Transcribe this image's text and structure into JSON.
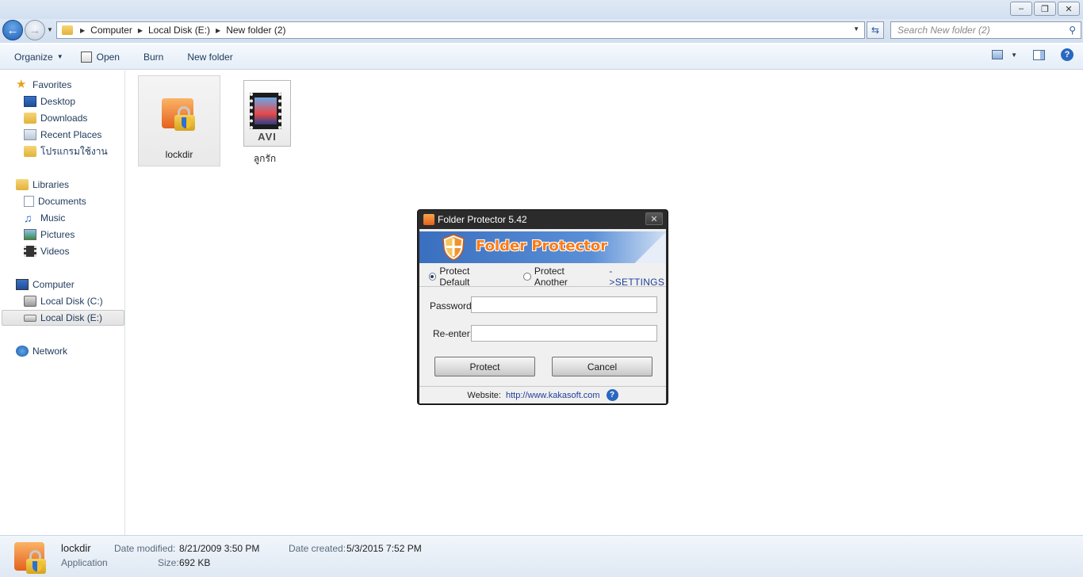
{
  "window": {
    "minimize_glyph": "–",
    "maximize_glyph": "❐",
    "close_glyph": "✕"
  },
  "address": {
    "crumbs": [
      "Computer",
      "Local Disk (E:)",
      "New folder (2)"
    ],
    "search_placeholder": "Search New folder (2)"
  },
  "toolbar": {
    "organize_label": "Organize",
    "open_label": "Open",
    "burn_label": "Burn",
    "new_folder_label": "New folder",
    "help_glyph": "?"
  },
  "sidebar": {
    "favorites": "Favorites",
    "desktop": "Desktop",
    "downloads": "Downloads",
    "recent_places": "Recent Places",
    "thai_folder": "โปรแกรมใช้งาน",
    "libraries": "Libraries",
    "documents": "Documents",
    "music": "Music",
    "pictures": "Pictures",
    "videos": "Videos",
    "computer": "Computer",
    "local_disk_c": "Local Disk (C:)",
    "local_disk_e": "Local Disk (E:)",
    "network": "Network"
  },
  "files": [
    {
      "name": "lockdir",
      "selected": true
    },
    {
      "name": "ลูกรัก",
      "badge": "AVI"
    }
  ],
  "dialog": {
    "title": "Folder Protector 5.42",
    "close_glyph": "✕",
    "banner": "Folder Protector",
    "option_default": "Protect Default",
    "option_another": "Protect Another",
    "settings_link": "->SETTINGS",
    "password_label": "Password:",
    "reenter_label": "Re-enter:",
    "password_value": "",
    "reenter_value": "",
    "protect_label": "Protect",
    "cancel_label": "Cancel",
    "website_label": "Website:",
    "website_url": "http://www.kakasoft.com",
    "help_glyph": "?"
  },
  "details": {
    "name": "lockdir",
    "type": "Application",
    "modified_key": "Date modified:",
    "modified_value": "8/21/2009 3:50 PM",
    "size_key": "Size:",
    "size_value": "692 KB",
    "created_key": "Date created:",
    "created_value": "5/3/2015 7:52 PM"
  }
}
